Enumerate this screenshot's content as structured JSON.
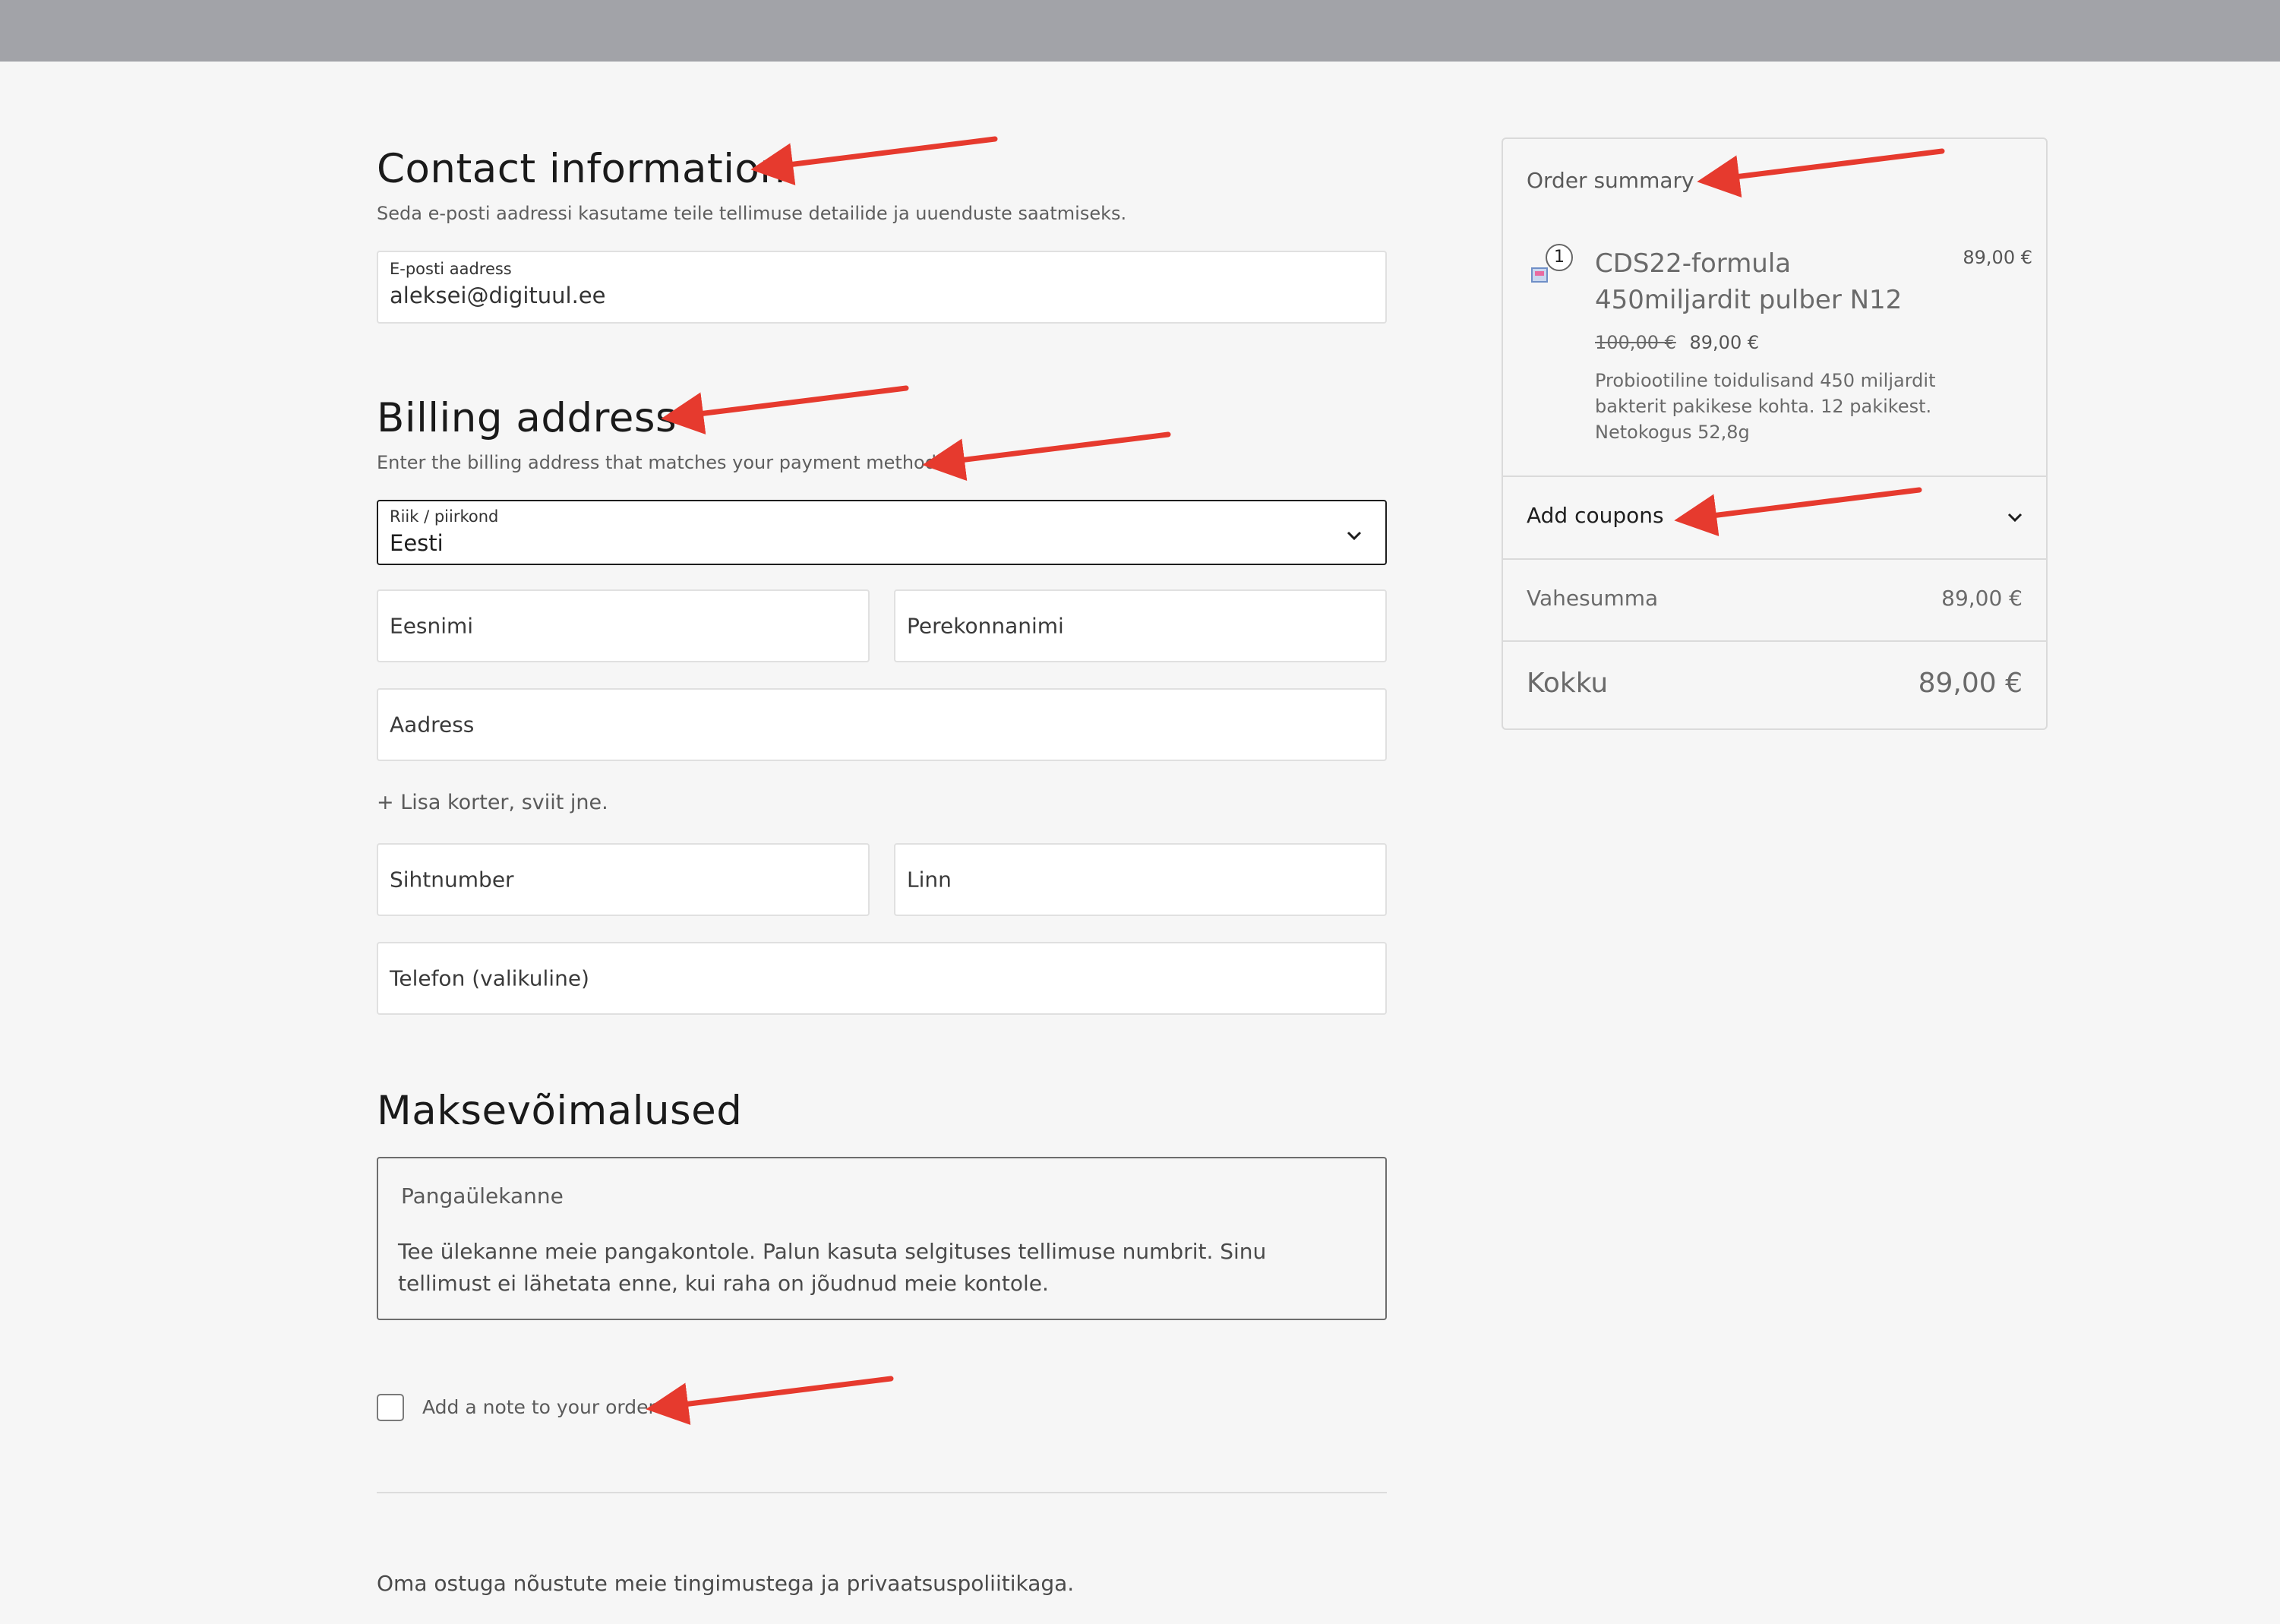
{
  "contact": {
    "heading": "Contact information",
    "subtitle": "Seda e-posti aadressi kasutame teile tellimuse detailide ja uuenduste saatmiseks.",
    "email_label": "E-posti aadress",
    "email_value": "aleksei@digituul.ee"
  },
  "billing": {
    "heading": "Billing address",
    "subtitle": "Enter the billing address that matches your payment method.",
    "country_label": "Riik / piirkond",
    "country_value": "Eesti",
    "first_name": "Eesnimi",
    "last_name": "Perekonnanimi",
    "address": "Aadress",
    "add_apartment": "+ Lisa korter, sviit jne.",
    "postcode": "Sihtnumber",
    "city": "Linn",
    "phone": "Telefon (valikuline)"
  },
  "payment": {
    "heading": "Maksevõimalused",
    "method_title": "Pangaülekanne",
    "method_desc": "Tee ülekanne meie pangakontole. Palun kasuta selgituses tellimuse numbrit. Sinu tellimust ei lähetata enne, kui raha on jõudnud meie kontole."
  },
  "note": {
    "label": "Add a note to your order"
  },
  "terms": "Oma ostuga nõustute meie tingimustega ja privaatsuspoliitikaga.",
  "summary": {
    "title": "Order summary",
    "item": {
      "quantity": "1",
      "name": "CDS22-formula 450miljardit pulber N12",
      "line_price": "89,00 €",
      "old_price": "100,00 €",
      "new_price": "89,00 €",
      "description": "Probiootiline toidulisand 450 miljardit bakterit pakikese kohta. 12 pakikest. Netokogus 52,8g"
    },
    "coupons_label": "Add coupons",
    "subtotal_label": "Vahesumma",
    "subtotal_value": "89,00 €",
    "total_label": "Kokku",
    "total_value": "89,00 €"
  },
  "colors": {
    "annotation_arrow": "#e63a2e",
    "background": "#f6f6f6",
    "topbar": "#a2a3a8"
  },
  "icons": {
    "chevron": "chevron-down-icon",
    "product": "product-thumbnail-icon"
  }
}
